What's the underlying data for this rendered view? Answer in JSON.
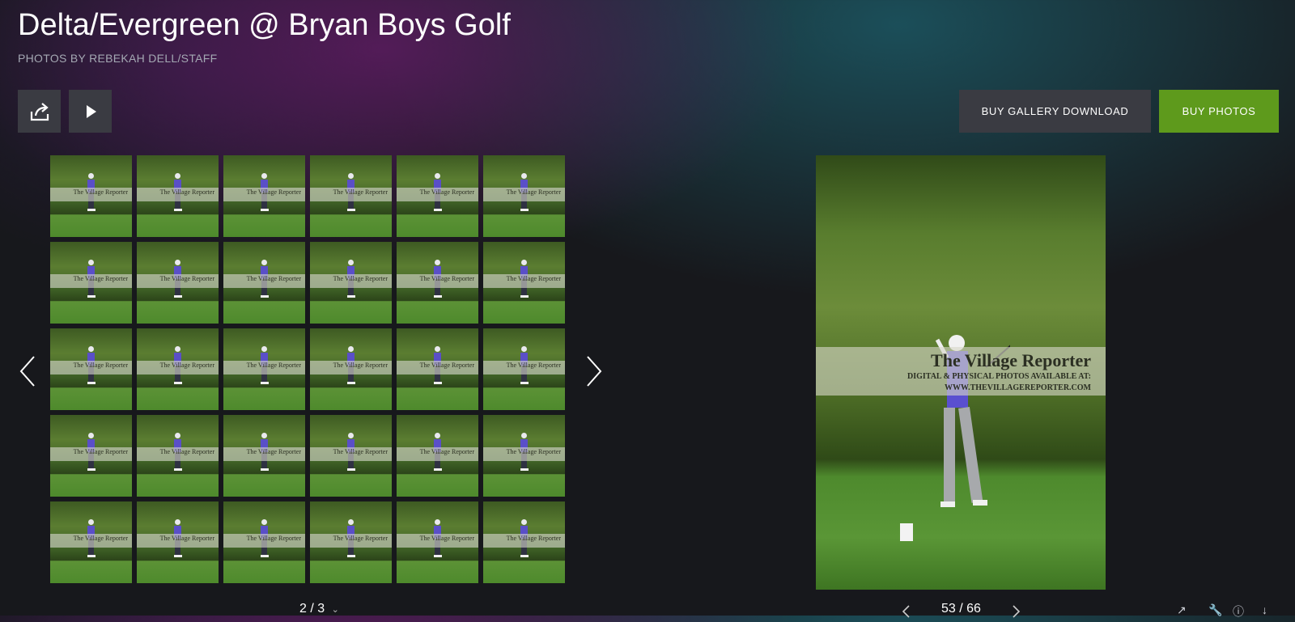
{
  "gallery": {
    "title": "Delta/Evergreen @ Bryan Boys Golf",
    "credit": "PHOTOS BY REBEKAH DELL/STAFF"
  },
  "toolbar": {
    "share_icon": "share-icon",
    "play_icon": "play-icon",
    "buy_gallery_label": "BUY GALLERY DOWNLOAD",
    "buy_photos_label": "BUY PHOTOS",
    "buy_photos_color": "#5e9a1c"
  },
  "thumbnails": {
    "watermark": "The Village Reporter",
    "count": 30,
    "page_indicator": "2 / 3"
  },
  "viewer": {
    "watermark_title": "The Village Reporter",
    "watermark_line1": "DIGITAL & PHYSICAL PHOTOS AVAILABLE AT:",
    "watermark_line2": "WWW.THEVILLAGEREPORTER.COM",
    "counter": "53 / 66"
  }
}
